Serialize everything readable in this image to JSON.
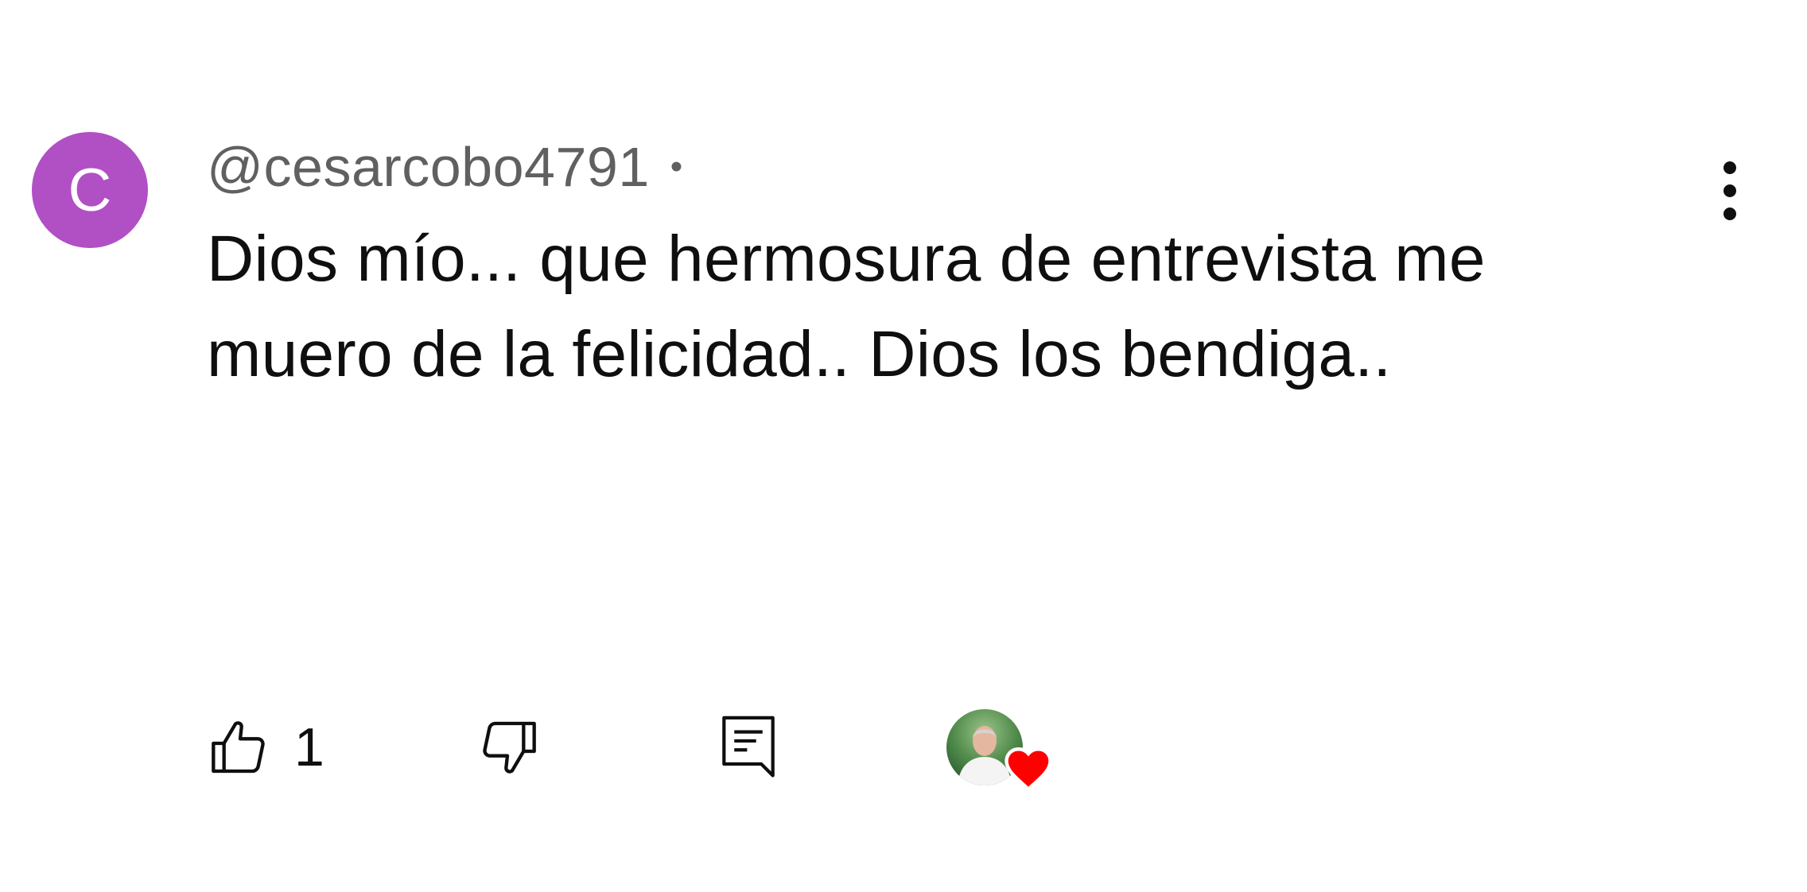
{
  "comment": {
    "avatar_letter": "C",
    "avatar_color": "#b14fc5",
    "author": "@cesarcobo4791",
    "separator": "•",
    "timestamp": "",
    "text": "Dios mío... que hermosura de entrevista me muero de la felicidad.. Dios los bendiga..",
    "menu_icon": "more-vert-icon"
  },
  "actions": {
    "like_icon": "thumb-up-icon",
    "like_count": "1",
    "dislike_icon": "thumb-down-icon",
    "reply_icon": "reply-comment-icon",
    "creator_heart_icon": "heart-icon",
    "heart_color": "#ff0000"
  }
}
